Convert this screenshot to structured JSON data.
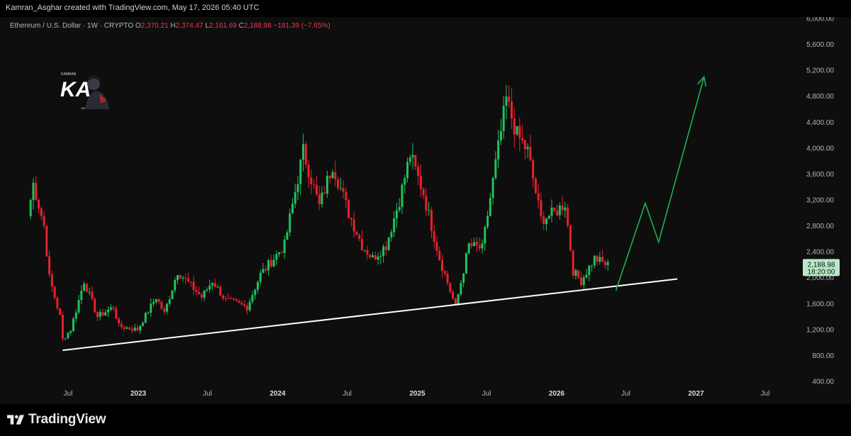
{
  "header": {
    "credit": "Kamran_Asghar created with TradingView.com, May 17, 2026 05:40 UTC"
  },
  "legend": {
    "symbol": "Ethereum / U.S. Dollar · 1W · CRYPTO",
    "o_label": "O",
    "o_value": "2,370.21",
    "h_label": "H",
    "h_value": "2,374.47",
    "l_label": "L",
    "l_value": "2,161.69",
    "c_label": "C",
    "c_value": "2,188.98",
    "change": "−181.39 (−7.65%)"
  },
  "logo": {
    "initials": "KA",
    "top_text": "KAMRAN",
    "bottom_text": "ASGHAR"
  },
  "price_tag": {
    "price": "2,188.98",
    "countdown": "18:20:00"
  },
  "footer": {
    "brand": "TradingView"
  },
  "colors": {
    "up": "#22c15c",
    "down": "#e8202e",
    "trendline": "#ffffff",
    "projection": "#1fb148",
    "background": "#0e0e0f",
    "axis_text": "#b2b5be",
    "price_tag_bg": "#b9e8c8"
  },
  "chart_data": {
    "type": "candlestick",
    "title": "Ethereum / U.S. Dollar · 1W · CRYPTO",
    "y_ticks": [
      "6,000.00",
      "5,600.00",
      "5,200.00",
      "4,800.00",
      "4,400.00",
      "4,000.00",
      "3,600.00",
      "3,200.00",
      "2,800.00",
      "2,400.00",
      "2,000.00",
      "1,600.00",
      "1,200.00",
      "800.00",
      "400.00"
    ],
    "y_tick_values": [
      6000,
      5600,
      5200,
      4800,
      4400,
      4000,
      3600,
      3200,
      2800,
      2400,
      2000,
      1600,
      1200,
      800,
      400
    ],
    "x_ticks": [
      "Jul",
      "2023",
      "Jul",
      "2024",
      "Jul",
      "2025",
      "Jul",
      "2026",
      "Jul",
      "2027",
      "Jul"
    ],
    "x_tick_dates": [
      "2022-07-01",
      "2023-01-01",
      "2023-07-01",
      "2024-01-01",
      "2024-07-01",
      "2025-01-01",
      "2025-07-01",
      "2026-01-01",
      "2026-07-01",
      "2027-01-01",
      "2027-07-01"
    ],
    "ylim": [
      400,
      6000
    ],
    "price_path": [
      {
        "date": "2022-03-18",
        "close": 2950
      },
      {
        "date": "2022-04-01",
        "close": 3450
      },
      {
        "date": "2022-04-29",
        "close": 2800
      },
      {
        "date": "2022-05-13",
        "close": 2000
      },
      {
        "date": "2022-06-10",
        "close": 1400
      },
      {
        "date": "2022-06-17",
        "close": 1050
      },
      {
        "date": "2022-07-08",
        "close": 1200
      },
      {
        "date": "2022-08-12",
        "close": 1950
      },
      {
        "date": "2022-09-16",
        "close": 1400
      },
      {
        "date": "2022-10-28",
        "close": 1550
      },
      {
        "date": "2022-11-11",
        "close": 1250
      },
      {
        "date": "2022-12-30",
        "close": 1200
      },
      {
        "date": "2023-02-17",
        "close": 1700
      },
      {
        "date": "2023-03-10",
        "close": 1450
      },
      {
        "date": "2023-04-14",
        "close": 2100
      },
      {
        "date": "2023-06-16",
        "close": 1700
      },
      {
        "date": "2023-07-14",
        "close": 1950
      },
      {
        "date": "2023-08-18",
        "close": 1650
      },
      {
        "date": "2023-10-13",
        "close": 1550
      },
      {
        "date": "2023-11-17",
        "close": 2050
      },
      {
        "date": "2023-12-22",
        "close": 2300
      },
      {
        "date": "2024-01-19",
        "close": 2500
      },
      {
        "date": "2024-03-08",
        "close": 3950
      },
      {
        "date": "2024-04-19",
        "close": 3100
      },
      {
        "date": "2024-05-24",
        "close": 3750
      },
      {
        "date": "2024-07-05",
        "close": 3000
      },
      {
        "date": "2024-08-09",
        "close": 2500
      },
      {
        "date": "2024-09-06",
        "close": 2300
      },
      {
        "date": "2024-10-11",
        "close": 2500
      },
      {
        "date": "2024-11-15",
        "close": 3200
      },
      {
        "date": "2024-12-13",
        "close": 3900
      },
      {
        "date": "2025-01-17",
        "close": 3300
      },
      {
        "date": "2025-02-28",
        "close": 2300
      },
      {
        "date": "2025-04-11",
        "close": 1550
      },
      {
        "date": "2025-05-16",
        "close": 2500
      },
      {
        "date": "2025-06-20",
        "close": 2450
      },
      {
        "date": "2025-07-25",
        "close": 3750
      },
      {
        "date": "2025-08-22",
        "close": 4750
      },
      {
        "date": "2025-09-19",
        "close": 4200
      },
      {
        "date": "2025-10-17",
        "close": 3950
      },
      {
        "date": "2025-11-21",
        "close": 2900
      },
      {
        "date": "2025-12-26",
        "close": 3000
      },
      {
        "date": "2026-01-23",
        "close": 3150
      },
      {
        "date": "2026-02-13",
        "close": 2100
      },
      {
        "date": "2026-03-06",
        "close": 1950
      },
      {
        "date": "2026-04-10",
        "close": 2300
      },
      {
        "date": "2026-05-15",
        "close": 2189
      }
    ],
    "trendline": [
      {
        "date": "2022-06-17",
        "price": 880
      },
      {
        "date": "2026-11-13",
        "price": 1980
      }
    ],
    "projection": [
      {
        "date": "2026-06-05",
        "price": 1800
      },
      {
        "date": "2026-08-21",
        "price": 3150
      },
      {
        "date": "2026-09-25",
        "price": 2550
      },
      {
        "date": "2027-01-22",
        "price": 5100
      }
    ]
  }
}
